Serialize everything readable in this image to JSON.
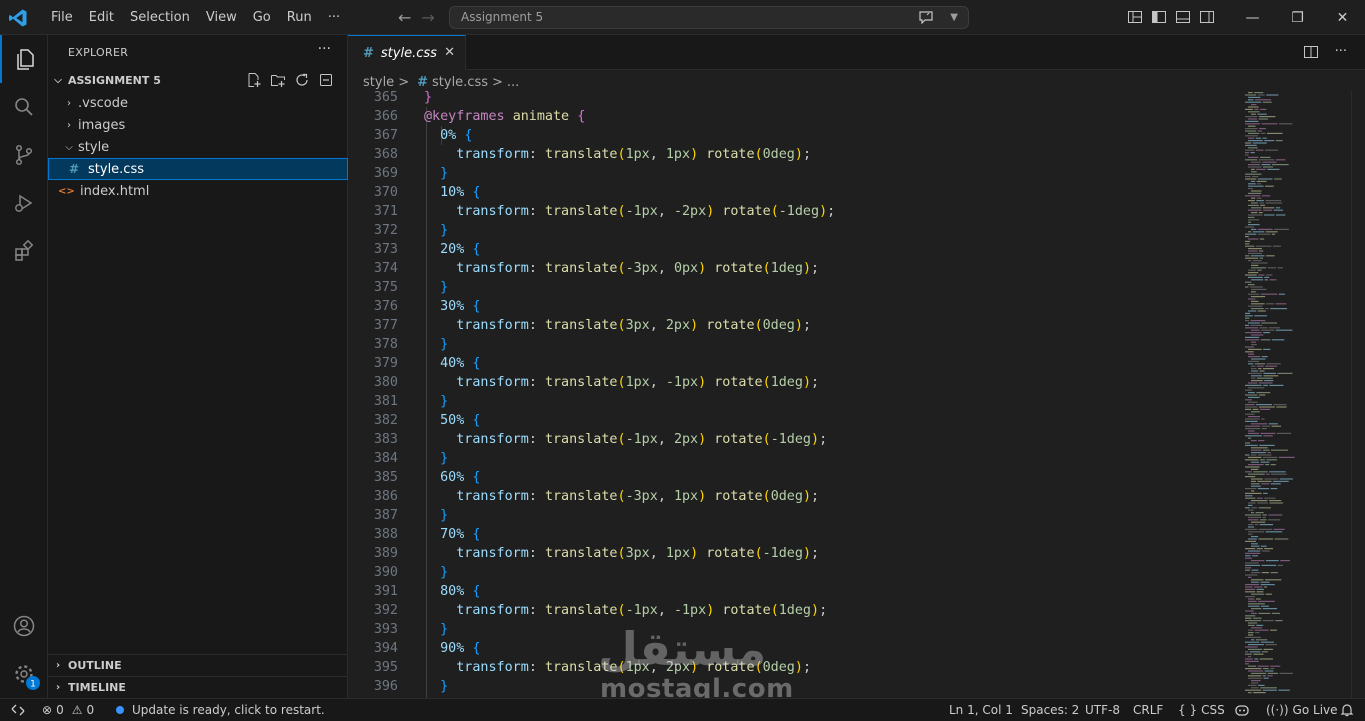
{
  "titlebar": {
    "menu": [
      "File",
      "Edit",
      "Selection",
      "View",
      "Go",
      "Run",
      "···"
    ],
    "search_text": "Assignment 5"
  },
  "explorer": {
    "title": "EXPLORER",
    "more": "···",
    "section": "ASSIGNMENT 5",
    "items": [
      {
        "label": ".vscode",
        "kind": "folder-collapsed"
      },
      {
        "label": "images",
        "kind": "folder-collapsed"
      },
      {
        "label": "style",
        "kind": "folder-expanded"
      },
      {
        "label": "style.css",
        "kind": "css-file",
        "icon_glyph": "#"
      },
      {
        "label": "index.html",
        "kind": "html-file",
        "icon_glyph": "<>"
      }
    ],
    "outline": "OUTLINE",
    "timeline": "TIMELINE"
  },
  "editor": {
    "tab_label": "style.css",
    "tab_hash": "#",
    "tab_close": "✕",
    "breadcrumb": {
      "folder": "style",
      "sep": ">",
      "hash": "#",
      "file": "style.css",
      "more": "..."
    },
    "lines": [
      {
        "num": "365",
        "text": "}"
      },
      {
        "num": "366",
        "text": "@keyframes animate {"
      },
      {
        "num": "367",
        "text": "  0% {"
      },
      {
        "num": "368",
        "text": "    transform: translate(1px, 1px) rotate(0deg);"
      },
      {
        "num": "369",
        "text": "  }"
      },
      {
        "num": "370",
        "text": "  10% {"
      },
      {
        "num": "371",
        "text": "    transform: translate(-1px, -2px) rotate(-1deg);"
      },
      {
        "num": "372",
        "text": "  }"
      },
      {
        "num": "373",
        "text": "  20% {"
      },
      {
        "num": "374",
        "text": "    transform: translate(-3px, 0px) rotate(1deg);"
      },
      {
        "num": "375",
        "text": "  }"
      },
      {
        "num": "376",
        "text": "  30% {"
      },
      {
        "num": "377",
        "text": "    transform: translate(3px, 2px) rotate(0deg);"
      },
      {
        "num": "378",
        "text": "  }"
      },
      {
        "num": "379",
        "text": "  40% {"
      },
      {
        "num": "380",
        "text": "    transform: translate(1px, -1px) rotate(1deg);"
      },
      {
        "num": "381",
        "text": "  }"
      },
      {
        "num": "382",
        "text": "  50% {"
      },
      {
        "num": "383",
        "text": "    transform: translate(-1px, 2px) rotate(-1deg);"
      },
      {
        "num": "384",
        "text": "  }"
      },
      {
        "num": "385",
        "text": "  60% {"
      },
      {
        "num": "386",
        "text": "    transform: translate(-3px, 1px) rotate(0deg);"
      },
      {
        "num": "387",
        "text": "  }"
      },
      {
        "num": "388",
        "text": "  70% {"
      },
      {
        "num": "389",
        "text": "    transform: translate(3px, 1px) rotate(-1deg);"
      },
      {
        "num": "390",
        "text": "  }"
      },
      {
        "num": "391",
        "text": "  80% {"
      },
      {
        "num": "392",
        "text": "    transform: translate(-1px, -1px) rotate(1deg);"
      },
      {
        "num": "393",
        "text": "  }"
      },
      {
        "num": "394",
        "text": "  90% {"
      },
      {
        "num": "395",
        "text": "    transform: translate(1px, 2px) rotate(0deg);"
      },
      {
        "num": "396",
        "text": "  }"
      }
    ]
  },
  "watermark": {
    "arabic": "مستقل",
    "latin": "mostaql.com"
  },
  "statusbar": {
    "errors": "0",
    "warnings": "0",
    "update": "Update is ready, click to restart.",
    "position": "Ln 1, Col 1",
    "spaces": "Spaces: 2",
    "encoding": "UTF-8",
    "eol": "CRLF",
    "language": "CSS",
    "golive": "Go Live"
  },
  "colors": {
    "accent": "#0078d4",
    "selection": "#04395e",
    "update_dot": "#3794ff",
    "badge": "#0078d4"
  }
}
